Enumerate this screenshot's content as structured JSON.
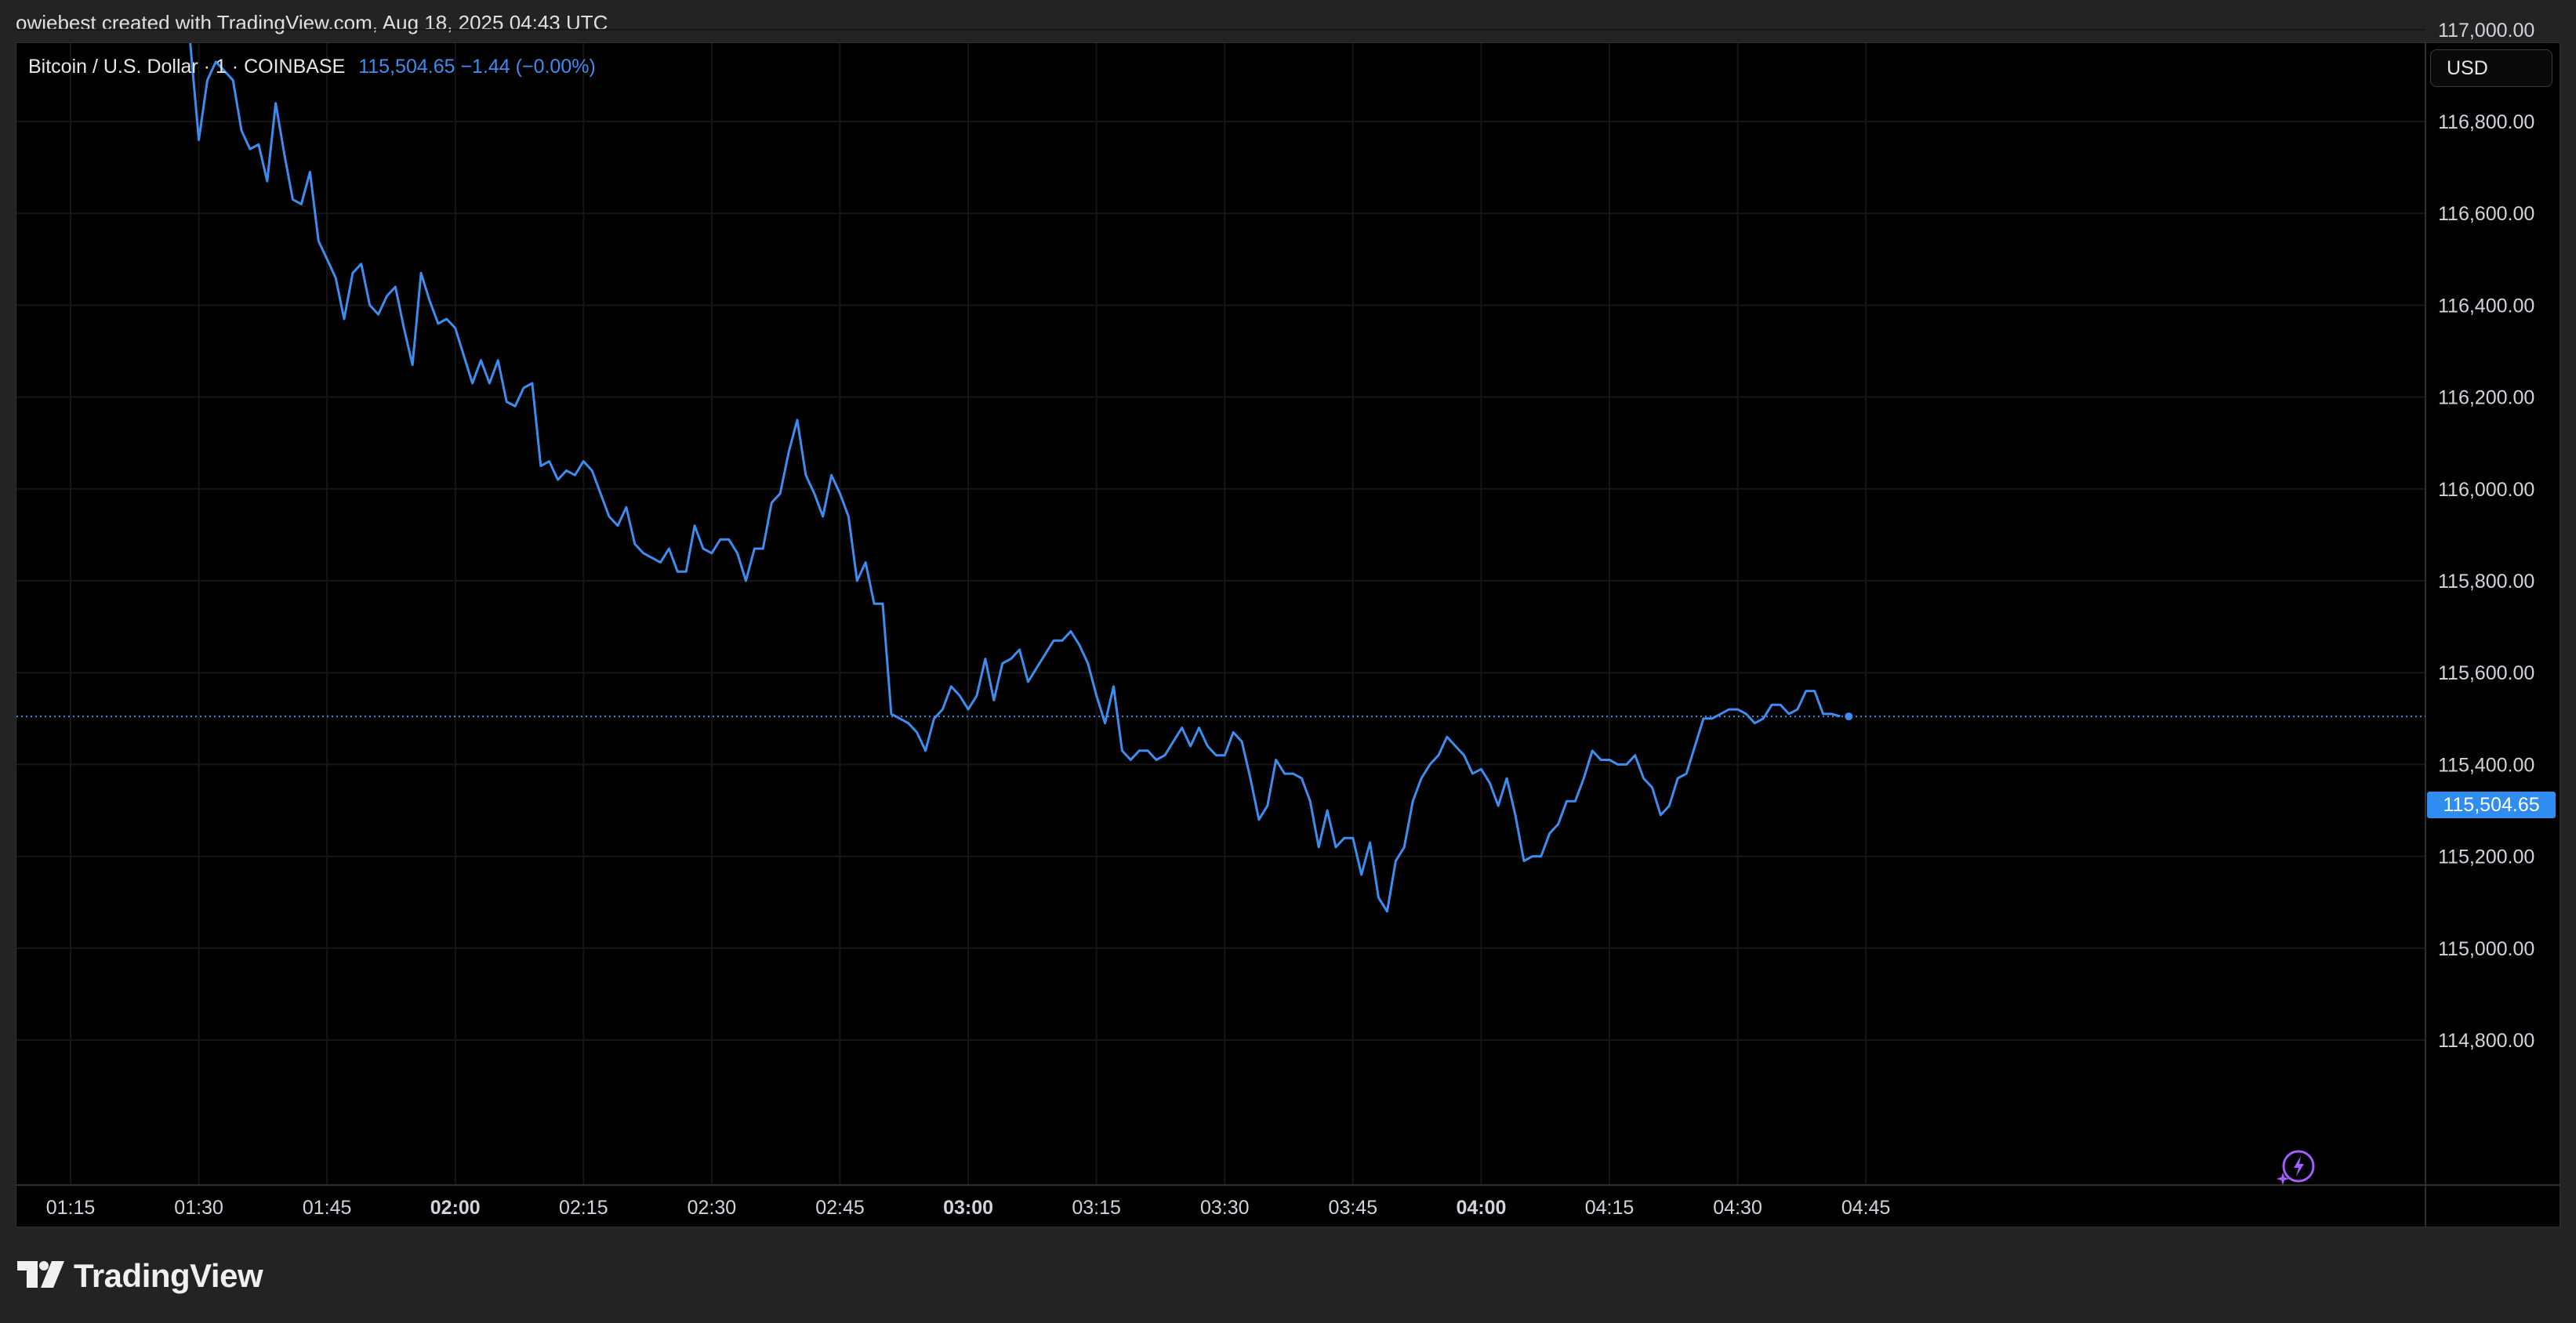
{
  "header": {
    "attribution": "owiebest created with TradingView.com, Aug 18, 2025 04:43 UTC"
  },
  "legend": {
    "symbol": "Bitcoin / U.S. Dollar · 1 · COINBASE",
    "value": "115,504.65  −1.44 (−0.00%)"
  },
  "price_scale": {
    "currency_label": "USD",
    "last_price_label": "115,504.65"
  },
  "footer": {
    "brand": "TradingView"
  },
  "colors": {
    "line": "#3d8cf0",
    "background": "#000000",
    "grid": "#161616",
    "frame": "#232323"
  },
  "icons": [
    "tradingview-logo-icon",
    "lightning-icon"
  ],
  "chart_data": {
    "type": "line",
    "title": "Bitcoin / U.S. Dollar · 1 · COINBASE",
    "xlabel": "",
    "ylabel": "",
    "ylim": [
      114700,
      117200
    ],
    "grid": true,
    "last_price": 115504.65,
    "y_ticks": [
      114800,
      115000,
      115200,
      115400,
      115600,
      115800,
      116000,
      116200,
      116400,
      116600,
      116800,
      117000
    ],
    "y_tick_labels": [
      "114,800.00",
      "115,000.00",
      "115,200.00",
      "115,400.00",
      "115,600.00",
      "115,800.00",
      "116,000.00",
      "116,200.00",
      "116,400.00",
      "116,600.00",
      "116,800.00",
      "117,000.00"
    ],
    "x_ticks": [
      {
        "label": "01:15",
        "bold": false
      },
      {
        "label": "01:30",
        "bold": false
      },
      {
        "label": "01:45",
        "bold": false
      },
      {
        "label": "02:00",
        "bold": true
      },
      {
        "label": "02:15",
        "bold": false
      },
      {
        "label": "02:30",
        "bold": false
      },
      {
        "label": "02:45",
        "bold": false
      },
      {
        "label": "03:00",
        "bold": true
      },
      {
        "label": "03:15",
        "bold": false
      },
      {
        "label": "03:30",
        "bold": false
      },
      {
        "label": "03:45",
        "bold": false
      },
      {
        "label": "04:00",
        "bold": true
      },
      {
        "label": "04:15",
        "bold": false
      },
      {
        "label": "04:30",
        "bold": false
      },
      {
        "label": "04:45",
        "bold": false
      }
    ],
    "x_start": "01:15",
    "x": [
      "01:29",
      "01:30",
      "01:31",
      "01:32",
      "01:33",
      "01:34",
      "01:35",
      "01:36",
      "01:37",
      "01:38",
      "01:39",
      "01:40",
      "01:41",
      "01:42",
      "01:43",
      "01:44",
      "01:45",
      "01:46",
      "01:47",
      "01:48",
      "01:49",
      "01:50",
      "01:51",
      "01:52",
      "01:53",
      "01:54",
      "01:55",
      "01:56",
      "01:57",
      "01:58",
      "01:59",
      "02:00",
      "02:01",
      "02:02",
      "02:03",
      "02:04",
      "02:05",
      "02:06",
      "02:07",
      "02:08",
      "02:09",
      "02:10",
      "02:11",
      "02:12",
      "02:13",
      "02:14",
      "02:15",
      "02:16",
      "02:17",
      "02:18",
      "02:19",
      "02:20",
      "02:21",
      "02:22",
      "02:23",
      "02:24",
      "02:25",
      "02:26",
      "02:27",
      "02:28",
      "02:29",
      "02:30",
      "02:31",
      "02:32",
      "02:33",
      "02:34",
      "02:35",
      "02:36",
      "02:37",
      "02:38",
      "02:39",
      "02:40",
      "02:41",
      "02:42",
      "02:43",
      "02:44",
      "02:45",
      "02:46",
      "02:47",
      "02:48",
      "02:49",
      "02:50",
      "02:51",
      "02:52",
      "02:53",
      "02:54",
      "02:55",
      "02:56",
      "02:57",
      "02:58",
      "02:59",
      "03:00",
      "03:01",
      "03:02",
      "03:03",
      "03:04",
      "03:05",
      "03:06",
      "03:07",
      "03:08",
      "03:09",
      "03:10",
      "03:11",
      "03:12",
      "03:13",
      "03:14",
      "03:15",
      "03:16",
      "03:17",
      "03:18",
      "03:19",
      "03:20",
      "03:21",
      "03:22",
      "03:23",
      "03:24",
      "03:25",
      "03:26",
      "03:27",
      "03:28",
      "03:29",
      "03:30",
      "03:31",
      "03:32",
      "03:33",
      "03:34",
      "03:35",
      "03:36",
      "03:37",
      "03:38",
      "03:39",
      "03:40",
      "03:41",
      "03:42",
      "03:43",
      "03:44",
      "03:45",
      "03:46",
      "03:47",
      "03:48",
      "03:49",
      "03:50",
      "03:51",
      "03:52",
      "03:53",
      "03:54",
      "03:55",
      "03:56",
      "03:57",
      "03:58",
      "03:59",
      "04:00",
      "04:01",
      "04:02",
      "04:03",
      "04:04",
      "04:05",
      "04:06",
      "04:07",
      "04:08",
      "04:09",
      "04:10",
      "04:11",
      "04:12",
      "04:13",
      "04:14",
      "04:15",
      "04:16",
      "04:17",
      "04:18",
      "04:19",
      "04:20",
      "04:21",
      "04:22",
      "04:23",
      "04:24",
      "04:25",
      "04:26",
      "04:27",
      "04:28",
      "04:29",
      "04:30",
      "04:31",
      "04:32",
      "04:33",
      "04:34",
      "04:35",
      "04:36",
      "04:37",
      "04:38",
      "04:39",
      "04:40",
      "04:41",
      "04:42",
      "04:43"
    ],
    "series": [
      {
        "values": [
          117200,
          116760,
          116890,
          116930,
          116910,
          116890,
          116780,
          116740,
          116750,
          116670,
          116840,
          116730,
          116630,
          116620,
          116690,
          116540,
          116500,
          116460,
          116370,
          116470,
          116490,
          116400,
          116380,
          116420,
          116440,
          116350,
          116270,
          116470,
          116410,
          116360,
          116370,
          116350,
          116290,
          116230,
          116280,
          116230,
          116280,
          116190,
          116180,
          116220,
          116230,
          116050,
          116060,
          116020,
          116040,
          116030,
          116060,
          116040,
          115990,
          115940,
          115920,
          115960,
          115880,
          115860,
          115850,
          115840,
          115870,
          115820,
          115820,
          115920,
          115870,
          115860,
          115890,
          115890,
          115860,
          115800,
          115870,
          115870,
          115970,
          115990,
          116080,
          116150,
          116030,
          115990,
          115940,
          116030,
          115990,
          115940,
          115800,
          115840,
          115750,
          115750,
          115510,
          115500,
          115490,
          115470,
          115430,
          115500,
          115520,
          115570,
          115550,
          115520,
          115550,
          115630,
          115540,
          115620,
          115630,
          115650,
          115580,
          115610,
          115640,
          115670,
          115670,
          115690,
          115660,
          115620,
          115550,
          115490,
          115570,
          115430,
          115410,
          115430,
          115430,
          115410,
          115420,
          115450,
          115480,
          115440,
          115480,
          115440,
          115420,
          115420,
          115470,
          115450,
          115370,
          115280,
          115310,
          115410,
          115380,
          115380,
          115370,
          115320,
          115220,
          115300,
          115220,
          115240,
          115240,
          115160,
          115230,
          115110,
          115080,
          115190,
          115220,
          115320,
          115370,
          115400,
          115420,
          115460,
          115440,
          115420,
          115380,
          115390,
          115360,
          115310,
          115370,
          115290,
          115190,
          115200,
          115200,
          115250,
          115270,
          115320,
          115320,
          115370,
          115430,
          115410,
          115410,
          115400,
          115400,
          115420,
          115370,
          115350,
          115290,
          115310,
          115370,
          115380,
          115440,
          115500,
          115500,
          115510,
          115520,
          115520,
          115510,
          115490,
          115500,
          115530,
          115530,
          115510,
          115520,
          115560,
          115560,
          115510,
          115510,
          115505
        ]
      }
    ]
  }
}
